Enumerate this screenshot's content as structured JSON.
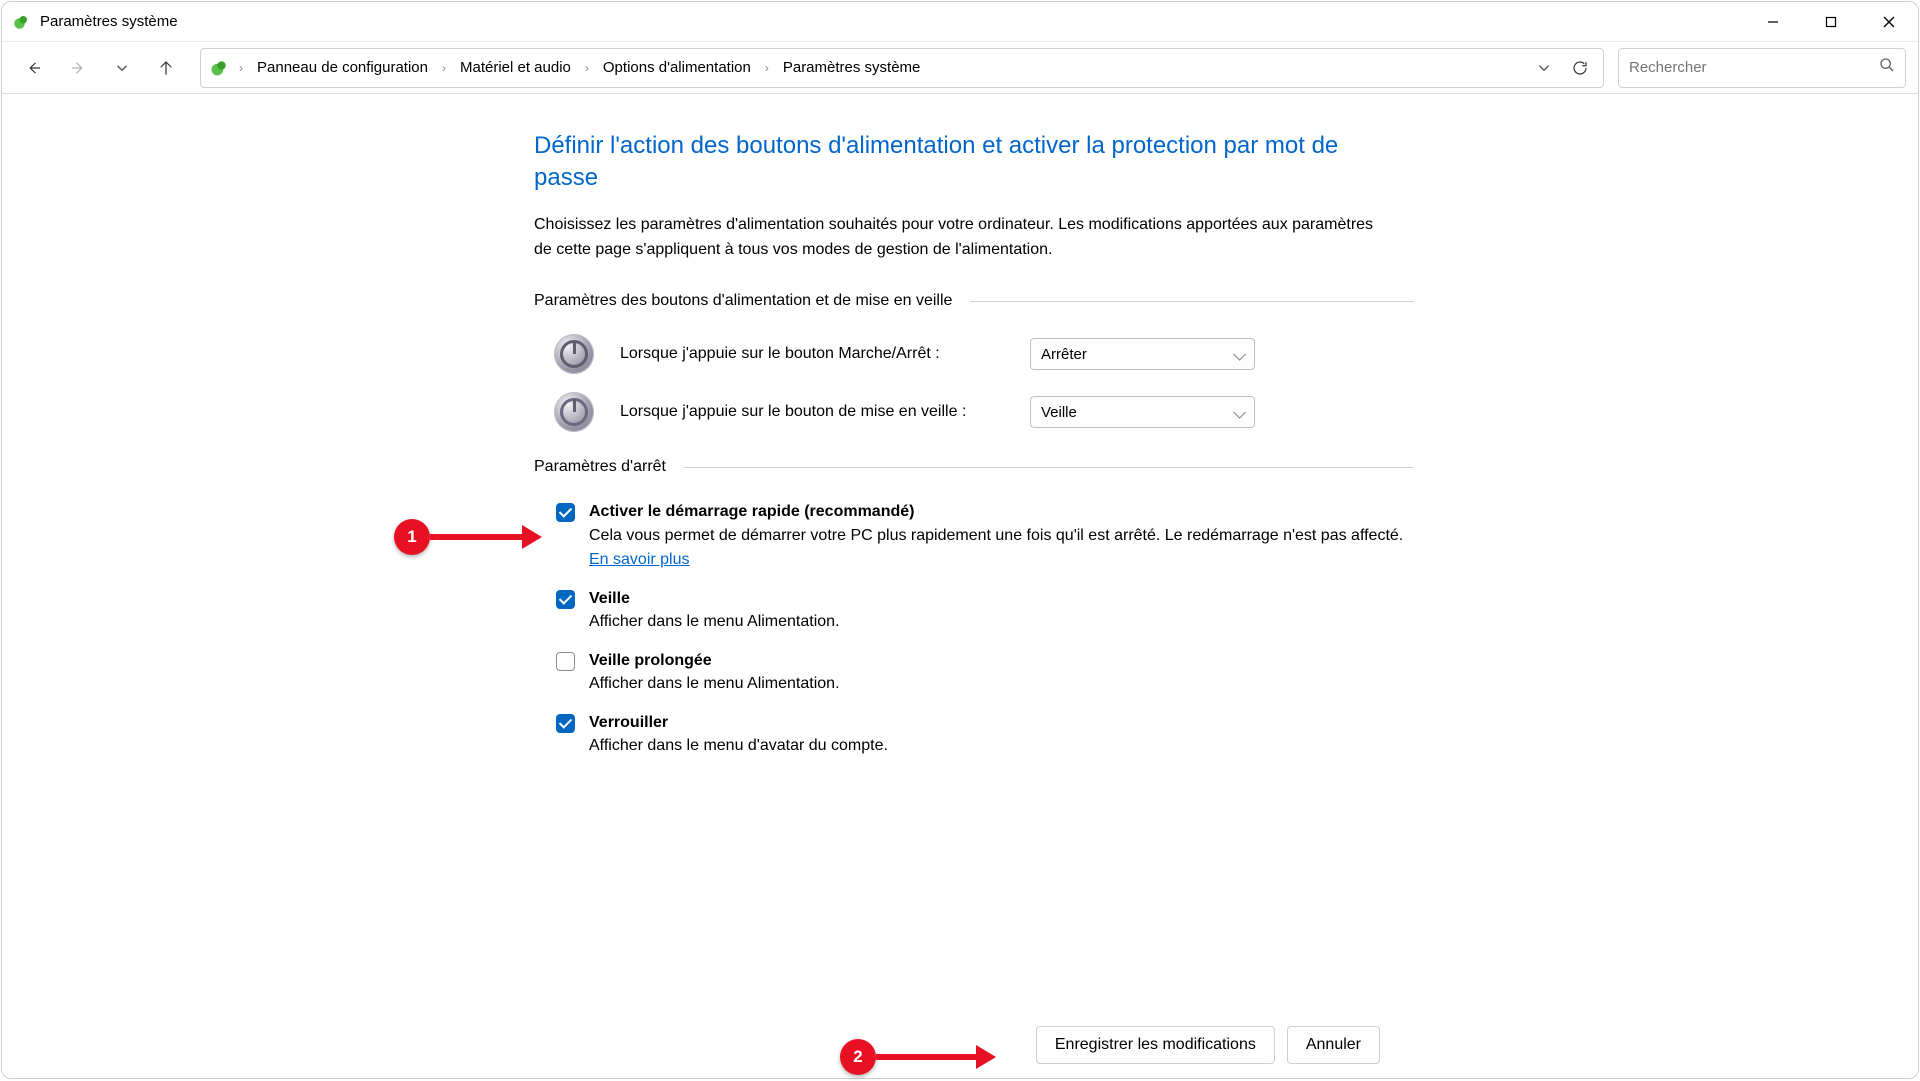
{
  "window": {
    "title": "Paramètres système"
  },
  "breadcrumb": {
    "items": [
      "Panneau de configuration",
      "Matériel et audio",
      "Options d'alimentation",
      "Paramètres système"
    ]
  },
  "search": {
    "placeholder": "Rechercher"
  },
  "page": {
    "title": "Définir l'action des boutons d'alimentation et activer la protection par mot de passe",
    "desc": "Choisissez les paramètres d'alimentation souhaités pour votre ordinateur. Les modifications apportées aux paramètres de cette page s'appliquent à tous vos modes de gestion de l'alimentation."
  },
  "section_buttons": {
    "header": "Paramètres des boutons d'alimentation et de mise en veille",
    "power_label": "Lorsque j'appuie sur le bouton Marche/Arrêt :",
    "power_value": "Arrêter",
    "sleep_label": "Lorsque j'appuie sur le bouton de mise en veille :",
    "sleep_value": "Veille"
  },
  "section_shutdown": {
    "header": "Paramètres d'arrêt",
    "items": [
      {
        "checked": true,
        "title": "Activer le démarrage rapide (recommandé)",
        "desc_pre": "Cela vous permet de démarrer votre PC plus rapidement une fois qu'il est arrêté. Le redémarrage n'est pas affecté. ",
        "link": "En savoir plus"
      },
      {
        "checked": true,
        "title": "Veille",
        "desc": "Afficher dans le menu Alimentation."
      },
      {
        "checked": false,
        "title": "Veille prolongée",
        "desc": "Afficher dans le menu Alimentation."
      },
      {
        "checked": true,
        "title": "Verrouiller",
        "desc": "Afficher dans le menu d'avatar du compte."
      }
    ]
  },
  "actions": {
    "save": "Enregistrer les modifications",
    "cancel": "Annuler"
  },
  "annotations": {
    "one": "1",
    "two": "2"
  }
}
